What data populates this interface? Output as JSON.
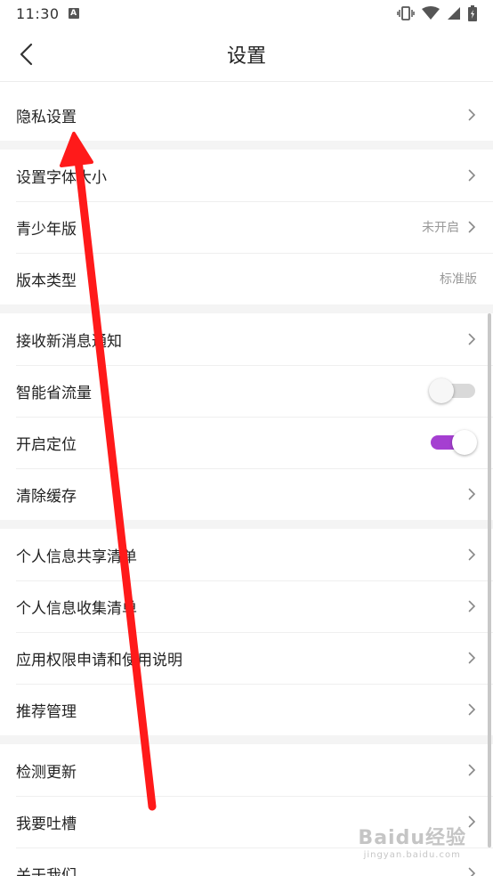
{
  "status_bar": {
    "time": "11:30",
    "badge": "A"
  },
  "header": {
    "title": "设置"
  },
  "sections": [
    {
      "rows": [
        {
          "label": "隐私设置",
          "type": "nav"
        }
      ]
    },
    {
      "rows": [
        {
          "label": "设置字体大小",
          "type": "nav"
        },
        {
          "label": "青少年版",
          "type": "nav",
          "value": "未开启"
        },
        {
          "label": "版本类型",
          "type": "value",
          "value": "标准版"
        }
      ]
    },
    {
      "rows": [
        {
          "label": "接收新消息通知",
          "type": "nav"
        },
        {
          "label": "智能省流量",
          "type": "toggle",
          "on": false
        },
        {
          "label": "开启定位",
          "type": "toggle",
          "on": true
        },
        {
          "label": "清除缓存",
          "type": "nav"
        }
      ]
    },
    {
      "rows": [
        {
          "label": "个人信息共享清单",
          "type": "nav"
        },
        {
          "label": "个人信息收集清单",
          "type": "nav"
        },
        {
          "label": "应用权限申请和使用说明",
          "type": "nav"
        },
        {
          "label": "推荐管理",
          "type": "nav"
        }
      ]
    },
    {
      "rows": [
        {
          "label": "检测更新",
          "type": "nav"
        },
        {
          "label": "我要吐槽",
          "type": "nav"
        },
        {
          "label": "关于我们",
          "type": "nav"
        }
      ]
    }
  ],
  "colors": {
    "toggle_on": "#a53fd1",
    "arrow": "#ff1a1a"
  },
  "watermark": {
    "main": "Baidu经验",
    "sub": "jingyan.baidu.com"
  }
}
